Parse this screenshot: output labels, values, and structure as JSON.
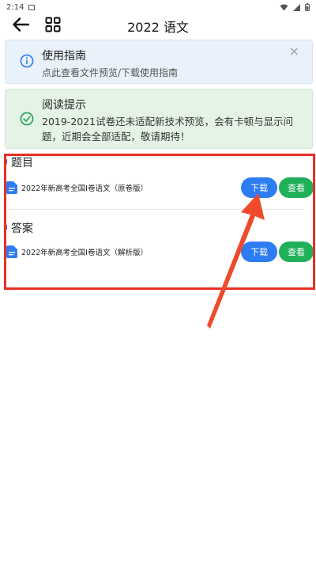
{
  "status_bar": {
    "time": "2:14"
  },
  "app_bar": {
    "title": "2022 语文"
  },
  "guide": {
    "title": "使用指南",
    "subtitle": "点此查看文件预览/下载使用指南",
    "close": "×"
  },
  "tip": {
    "title": "阅读提示",
    "body": "2019-2021试卷还未适配新技术预览，会有卡顿与显示问题，近期会全部适配，敬请期待！"
  },
  "sections": [
    {
      "title": "题目",
      "file_name": "2022年新高考全国I卷语文（原卷版）",
      "download_label": "下载",
      "view_label": "查看"
    },
    {
      "title": "答案",
      "file_name": "2022年新高考全国I卷语文（解析版）",
      "download_label": "下载",
      "view_label": "查看"
    }
  ],
  "colors": {
    "download": "#2d7cf2",
    "view": "#21b05a",
    "highlight": "#ea2f22",
    "arrow": "#f04a2c"
  }
}
